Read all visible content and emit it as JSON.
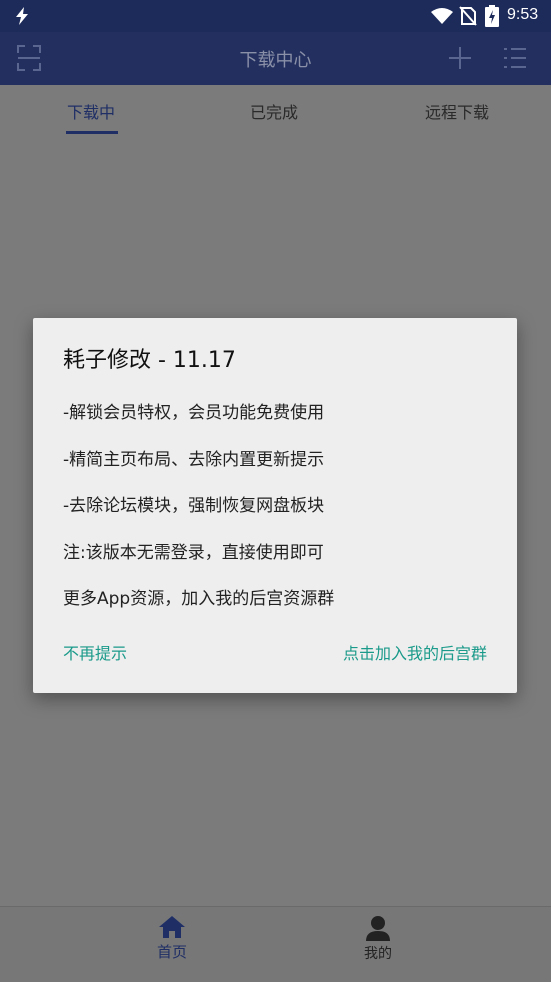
{
  "status": {
    "time": "9:53"
  },
  "appbar": {
    "title": "下载中心"
  },
  "tabs": [
    {
      "label": "下载中"
    },
    {
      "label": "已完成"
    },
    {
      "label": "远程下载"
    }
  ],
  "dialog": {
    "title": "耗子修改 - 11.17",
    "lines": [
      "-解锁会员特权，会员功能免费使用",
      "-精简主页布局、去除内置更新提示",
      "-去除论坛模块，强制恢复网盘板块",
      "注:该版本无需登录，直接使用即可",
      "更多App资源，加入我的后宫资源群"
    ],
    "dismiss_label": "不再提示",
    "join_label": "点击加入我的后宫群"
  },
  "bottomnav": [
    {
      "label": "首页",
      "icon": "home-icon"
    },
    {
      "label": "我的",
      "icon": "person-icon"
    }
  ],
  "colors": {
    "statusbar": "#1d2b5a",
    "appbar": "#23305f",
    "accent": "#1f2f66",
    "dialog_button": "#1a9a8a"
  }
}
